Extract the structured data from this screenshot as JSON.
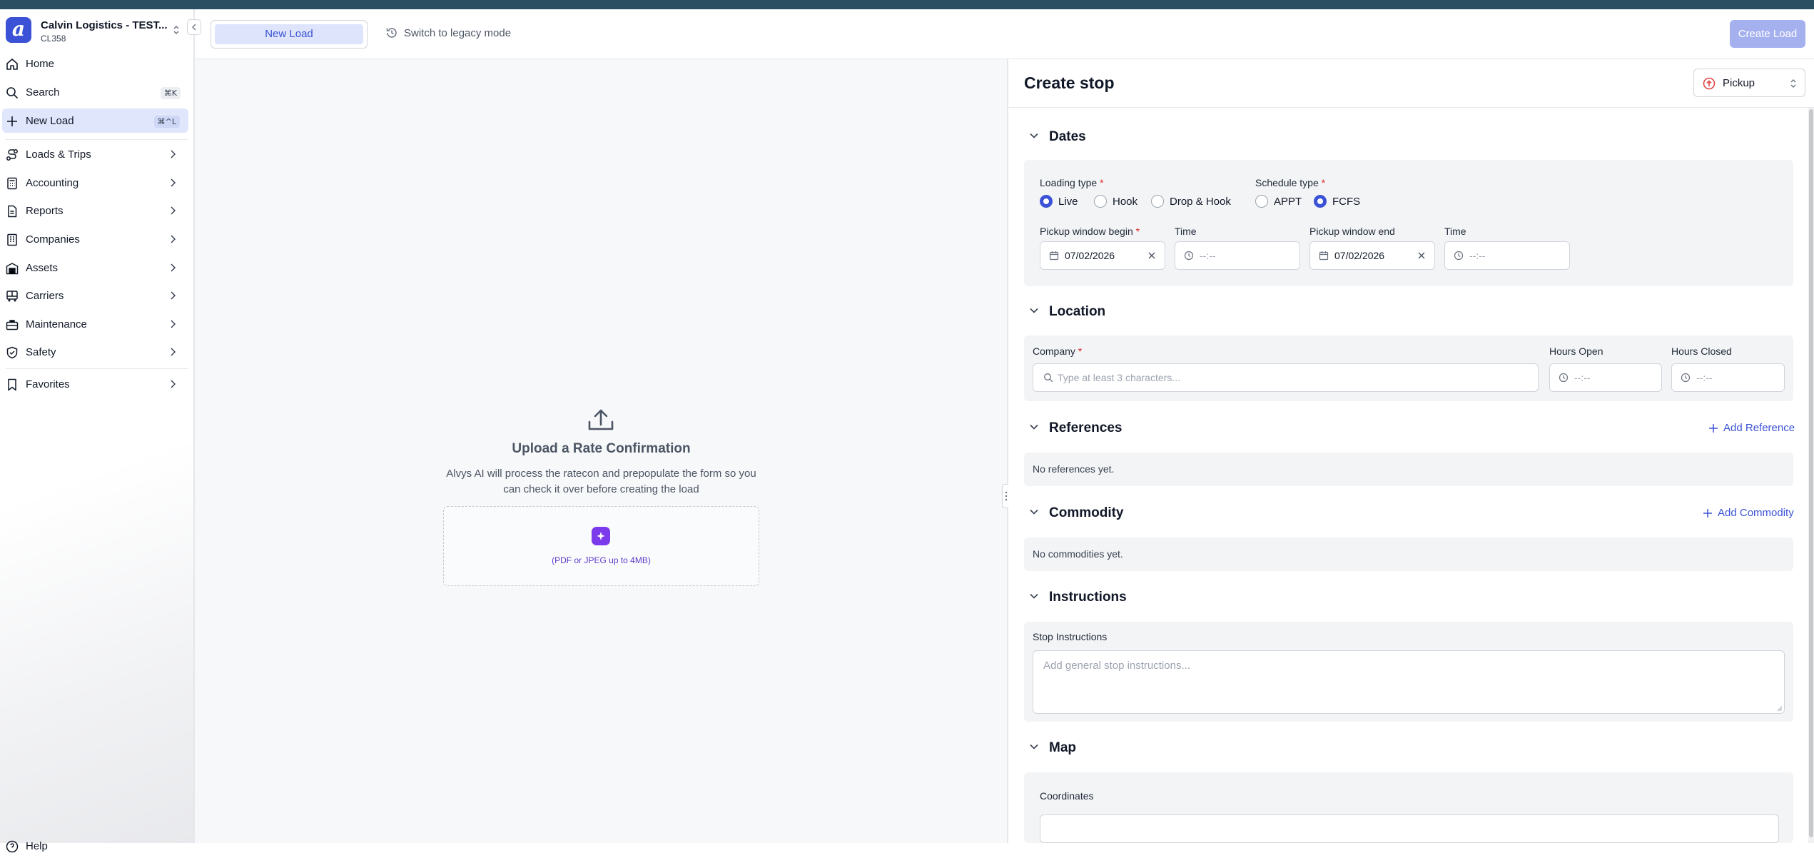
{
  "sidebar": {
    "org_name": "Calvin Logistics - TEST...",
    "org_code": "CL358",
    "items": [
      {
        "label": "Home"
      },
      {
        "label": "Search",
        "shortcut": "⌘K"
      },
      {
        "label": "New Load",
        "shortcut": "⌘^L"
      },
      {
        "label": "Loads & Trips"
      },
      {
        "label": "Accounting"
      },
      {
        "label": "Reports"
      },
      {
        "label": "Companies"
      },
      {
        "label": "Assets"
      },
      {
        "label": "Carriers"
      },
      {
        "label": "Maintenance"
      },
      {
        "label": "Safety"
      },
      {
        "label": "Favorites"
      }
    ],
    "help_label": "Help"
  },
  "header": {
    "tab_label": "New Load",
    "legacy_label": "Switch to legacy mode",
    "create_label": "Create Load"
  },
  "upload": {
    "title": "Upload a Rate Confirmation",
    "description": "Alvys AI will process the ratecon and prepopulate the form so you can check it over before creating the load",
    "hint": "(PDF or JPEG up to 4MB)"
  },
  "stop": {
    "title": "Create stop",
    "type_value": "Pickup",
    "dates": {
      "title": "Dates",
      "loading_type_label": "Loading type",
      "loading_options": [
        "Live",
        "Hook",
        "Drop & Hook"
      ],
      "loading_selected": "Live",
      "schedule_type_label": "Schedule type",
      "schedule_options": [
        "APPT",
        "FCFS"
      ],
      "schedule_selected": "FCFS",
      "window_begin_label": "Pickup window begin",
      "window_begin_value": "07/02/2026",
      "time_label": "Time",
      "time_placeholder": "--:--",
      "window_end_label": "Pickup window end",
      "window_end_value": "07/02/2026"
    },
    "location": {
      "title": "Location",
      "company_label": "Company",
      "company_placeholder": "Type at least 3 characters...",
      "hours_open_label": "Hours Open",
      "hours_closed_label": "Hours Closed",
      "time_placeholder": "--:--"
    },
    "references": {
      "title": "References",
      "add_label": "Add Reference",
      "empty": "No references yet."
    },
    "commodity": {
      "title": "Commodity",
      "add_label": "Add Commodity",
      "empty": "No commodities yet."
    },
    "instructions": {
      "title": "Instructions",
      "label": "Stop Instructions",
      "placeholder": "Add general stop instructions..."
    },
    "map": {
      "title": "Map",
      "coordinates_label": "Coordinates"
    }
  },
  "colors": {
    "accent": "#3b52d6",
    "header_strip": "#2a4f62",
    "pickup_red": "#e04444"
  }
}
